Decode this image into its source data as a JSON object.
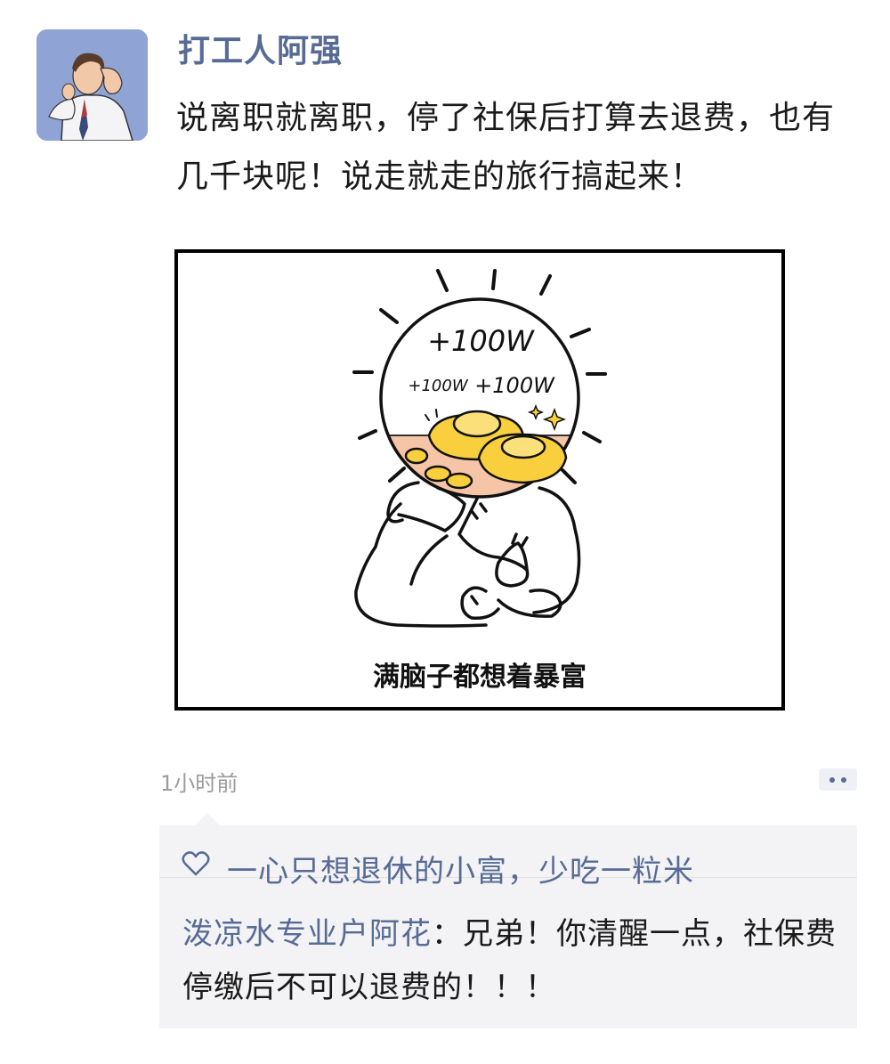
{
  "post": {
    "username": "打工人阿强",
    "text": "说离职就离职，停了社保后打算去退费，也有几千块呢！说走就走的旅行搞起来！",
    "image": {
      "bubble_big": "+100W",
      "bubble_small_left": "+100W",
      "bubble_small_right": "+100W",
      "caption": "满脑子都想着暴富"
    },
    "timestamp": "1小时前"
  },
  "interactions": {
    "likes_icon": "heart-outline-icon",
    "likes": "一心只想退休的小富，少吃一粒米",
    "comment": {
      "author": "泼凉水专业户阿花",
      "separator": "：",
      "text": "兄弟！你清醒一点，社保费停缴后不可以退费的！！！"
    }
  },
  "colors": {
    "link_blue": "#576b95",
    "comment_bg": "#f3f3f5",
    "avatar_bg": "#8fa4d4",
    "gold": "#f9cf3d",
    "peach": "#f6c4a6"
  }
}
